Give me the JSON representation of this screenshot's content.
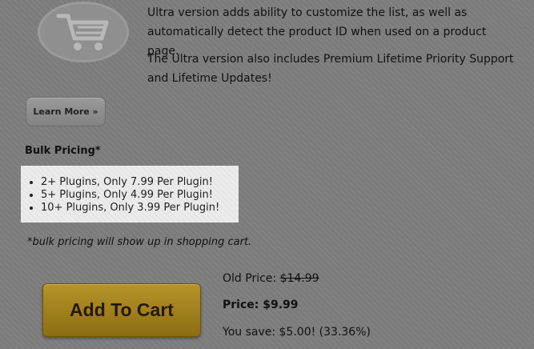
{
  "product": {
    "description_1": "Ultra version adds ability to customize the list, as well as automatically detect the product ID when used on a product page.",
    "description_2": "The Ultra version also includes Premium Lifetime Priority Support and Lifetime Updates!"
  },
  "learn_more_label": "Learn More »",
  "bulk_pricing": {
    "title": "Bulk Pricing*",
    "items": [
      "2+ Plugins, Only 7.99 Per Plugin!",
      "5+ Plugins, Only 4.99 Per Plugin!",
      "10+ Plugins, Only 3.99 Per Plugin!"
    ],
    "note": "*bulk pricing will show up in shopping cart."
  },
  "cart": {
    "button_label": "Add To Cart"
  },
  "pricing": {
    "old_label": "Old Price: ",
    "old_value": "$14.99",
    "price_label": "Price: $9.99",
    "save_label": "You save: $5.00! (33.36%)"
  },
  "icons": {
    "logo": "shopping-cart-icon"
  }
}
